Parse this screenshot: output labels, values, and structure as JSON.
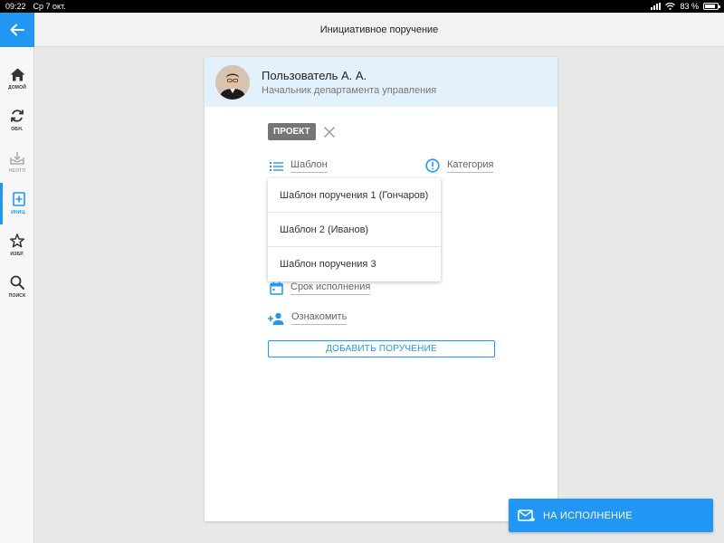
{
  "status_bar": {
    "time": "09:22",
    "date": "Ср 7 окт.",
    "battery": "83 %",
    "battery_fraction": 0.83
  },
  "header": {
    "title": "Инициативное поручение"
  },
  "sidebar": {
    "items": [
      {
        "id": "home",
        "label": "ДОМОЙ",
        "icon": "home-icon"
      },
      {
        "id": "refresh",
        "label": "ОБН.",
        "icon": "refresh-icon"
      },
      {
        "id": "unsent",
        "label": "НЕОТП",
        "icon": "outbox-icon",
        "disabled": true
      },
      {
        "id": "initiative",
        "label": "ИНИЦ.",
        "icon": "plus-box-icon",
        "active": true
      },
      {
        "id": "favorites",
        "label": "ИЗБР.",
        "icon": "star-icon"
      },
      {
        "id": "search",
        "label": "ПОИСК",
        "icon": "search-icon"
      }
    ]
  },
  "card": {
    "user_name": "Пользователь А. А.",
    "user_position": "Начальник департамента управления",
    "badge": "ПРОЕКТ",
    "template_label": "Шаблон",
    "category_label": "Категория",
    "templates": [
      "Шаблон поручения 1 (Гончаров)",
      "Шаблон 2 (Иванов)",
      "Шаблон поручения 3"
    ],
    "deadline_label": "Срок исполнения",
    "acquaint_label": "Ознакомить",
    "add_button": "ДОБАВИТЬ ПОРУЧЕНИЕ"
  },
  "footer": {
    "execute_button": "НА ИСПОЛНЕНИЕ"
  },
  "colors": {
    "accent": "#2196f3",
    "badge": "#757575",
    "card_header": "#e3f1fc"
  }
}
